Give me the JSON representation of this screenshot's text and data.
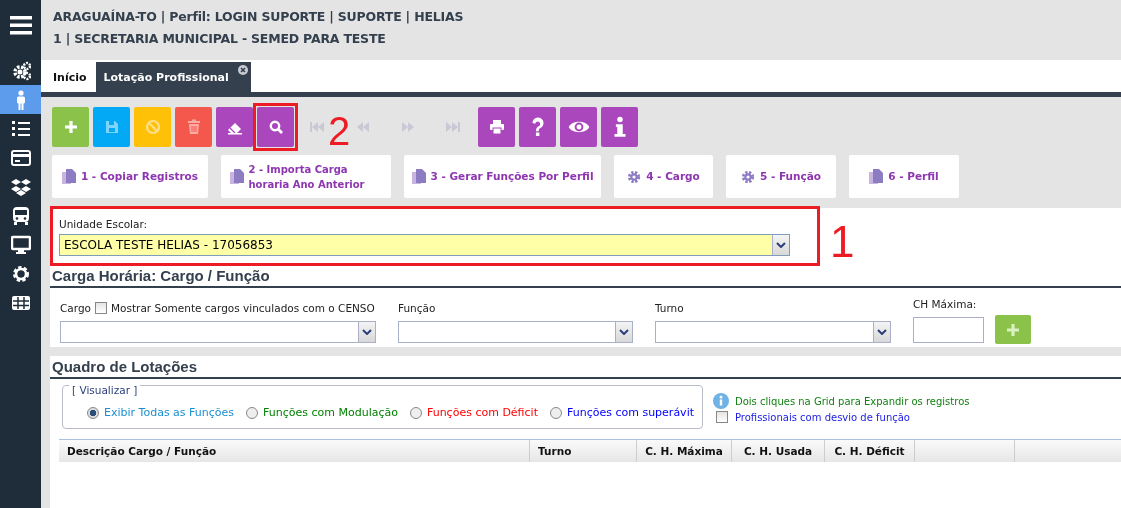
{
  "sidebar": {
    "items": [
      {
        "selected": false
      },
      {
        "selected": true
      },
      {
        "selected": false
      },
      {
        "selected": false
      },
      {
        "selected": false
      },
      {
        "selected": false
      },
      {
        "selected": false
      },
      {
        "selected": false
      },
      {
        "selected": false
      }
    ]
  },
  "header": {
    "lines": [
      "ARAGUAÍNA-TO | Perfil: LOGIN SUPORTE | SUPORTE | HELIAS",
      "1 | SECRETARIA MUNICIPAL - SEMED PARA TESTE"
    ]
  },
  "tabs": [
    {
      "label": "Início",
      "selected": false,
      "closable": false
    },
    {
      "label": "Lotação Profissional",
      "selected": true,
      "closable": true
    }
  ],
  "toolbar": [
    {
      "kind": "add",
      "color": "#8bc34a",
      "disabled": false
    },
    {
      "kind": "save",
      "color": "#03a9f4",
      "disabled": false
    },
    {
      "kind": "cancel",
      "color": "#ffc107",
      "disabled": false
    },
    {
      "kind": "delete",
      "color": "#f4574b",
      "disabled": false
    },
    {
      "kind": "erase",
      "color": "#ab47bc",
      "disabled": false
    },
    {
      "kind": "search",
      "color": "#ab47bc",
      "disabled": false,
      "marker": "2"
    },
    {
      "kind": "first",
      "disabled": true
    },
    {
      "kind": "prev",
      "disabled": true
    },
    {
      "kind": "next",
      "disabled": true
    },
    {
      "kind": "last",
      "disabled": true
    },
    {
      "kind": "print",
      "color": "#ab47bc",
      "disabled": false
    },
    {
      "kind": "help",
      "color": "#ab47bc",
      "disabled": false
    },
    {
      "kind": "view",
      "color": "#ab47bc",
      "disabled": false
    },
    {
      "kind": "info",
      "color": "#ab47bc",
      "disabled": false
    }
  ],
  "actions": [
    {
      "kind": "copy",
      "label": "1 - Copiar Registros"
    },
    {
      "kind": "copy",
      "label": "2 - Importa Carga horaria Ano Anterior"
    },
    {
      "kind": "copy",
      "label": "3 - Gerar Funções Por Perfil"
    },
    {
      "kind": "gear",
      "label": "4 - Cargo"
    },
    {
      "kind": "gear",
      "label": "5 - Função"
    },
    {
      "kind": "copy",
      "label": "6 - Perfil"
    }
  ],
  "school": {
    "label": "Unidade Escolar:",
    "value": "ESCOLA TESTE HELIAS - 17056853",
    "marker": "1"
  },
  "workload": {
    "title": "Carga Horária: Cargo / Função",
    "cargo": {
      "label": "Cargo",
      "checkbox": {
        "label": "Mostrar Somente cargos vinculados com o CENSO",
        "checked": false
      }
    },
    "funcao": {
      "label": "Função"
    },
    "turno": {
      "label": "Turno"
    },
    "ch_maxima": {
      "label": "CH Máxima:"
    },
    "add_button": {
      "disabled": true
    }
  },
  "board": {
    "title": "Quadro de Lotações",
    "view": {
      "legend": "[ Visualizar ]",
      "options": [
        {
          "label": "Exibir Todas as Funções",
          "color": "#1a8fd0",
          "selected": true
        },
        {
          "label": "Funções com Modulação",
          "color": "#008000",
          "selected": false
        },
        {
          "label": "Funções com Déficit",
          "color": "#ff0000",
          "selected": false
        },
        {
          "label": "Funções com superávit",
          "color": "#0000ff",
          "selected": false
        }
      ]
    },
    "hint": "Dois cliques na Grid para Expandir os registros",
    "deviation": {
      "label": "Profissionais com desvio de função",
      "checked": false
    },
    "table": {
      "columns": [
        "Descrição Cargo / Função",
        "Turno",
        "C. H. Máxima",
        "C. H. Usada",
        "C. H. Déficit"
      ]
    }
  }
}
